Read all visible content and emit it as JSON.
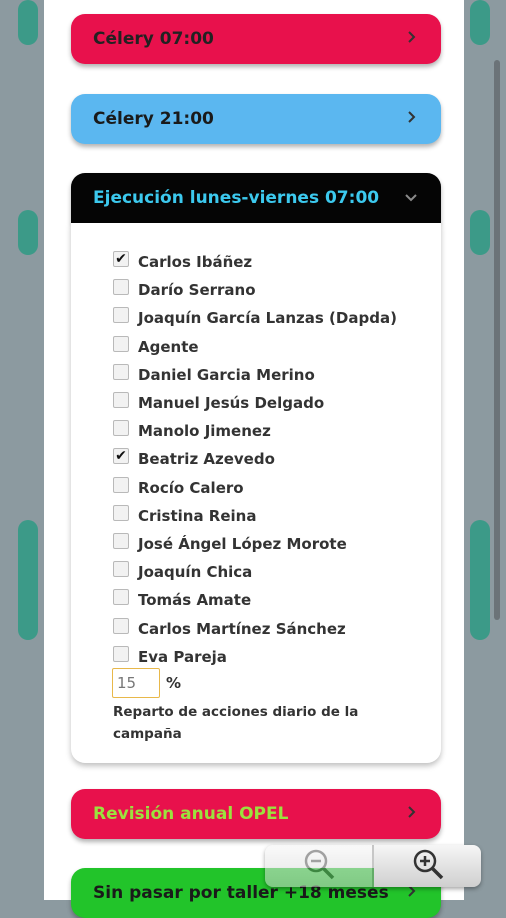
{
  "bars": {
    "top1": {
      "label": "Célery 07:00",
      "expanded": false
    },
    "top2": {
      "label": "Célery 21:00",
      "expanded": false
    },
    "open": {
      "label": "Ejecución lunes-viernes 07:00",
      "expanded": true
    },
    "after1": {
      "label": "Revisión anual OPEL",
      "expanded": false
    },
    "after2": {
      "label": "Sin pasar por taller +18 meses",
      "expanded": false
    }
  },
  "people": [
    {
      "name": "Carlos Ibáñez",
      "checked": true
    },
    {
      "name": "Darío Serrano",
      "checked": false
    },
    {
      "name": "Joaquín García Lanzas (Dapda)",
      "checked": false
    },
    {
      "name": "Agente",
      "checked": false
    },
    {
      "name": "Daniel Garcia Merino",
      "checked": false
    },
    {
      "name": "Manuel Jesús Delgado",
      "checked": false
    },
    {
      "name": "Manolo Jimenez",
      "checked": false
    },
    {
      "name": "Beatriz Azevedo",
      "checked": true
    },
    {
      "name": "Rocío Calero",
      "checked": false
    },
    {
      "name": "Cristina Reina",
      "checked": false
    },
    {
      "name": "José Ángel López Morote",
      "checked": false
    },
    {
      "name": "Joaquín Chica",
      "checked": false
    },
    {
      "name": "Tomás Amate",
      "checked": false
    },
    {
      "name": "Carlos Martínez Sánchez",
      "checked": false
    },
    {
      "name": "Eva Pareja",
      "checked": false
    }
  ],
  "percent": {
    "value": "15",
    "unit": "%"
  },
  "help_text": "Reparto de acciones diario de la campaña",
  "icons": {
    "collapsed": "chevron-right-icon",
    "expanded": "chevron-down-icon",
    "zoom_out": "zoom-out-icon",
    "zoom_in": "zoom-in-icon"
  },
  "colors": {
    "pink": "#e8114c",
    "blue": "#5bb7f0",
    "black": "#050505",
    "cyan_text": "#3cc9ee",
    "lime_text": "#9be23e",
    "green": "#22c42a"
  }
}
